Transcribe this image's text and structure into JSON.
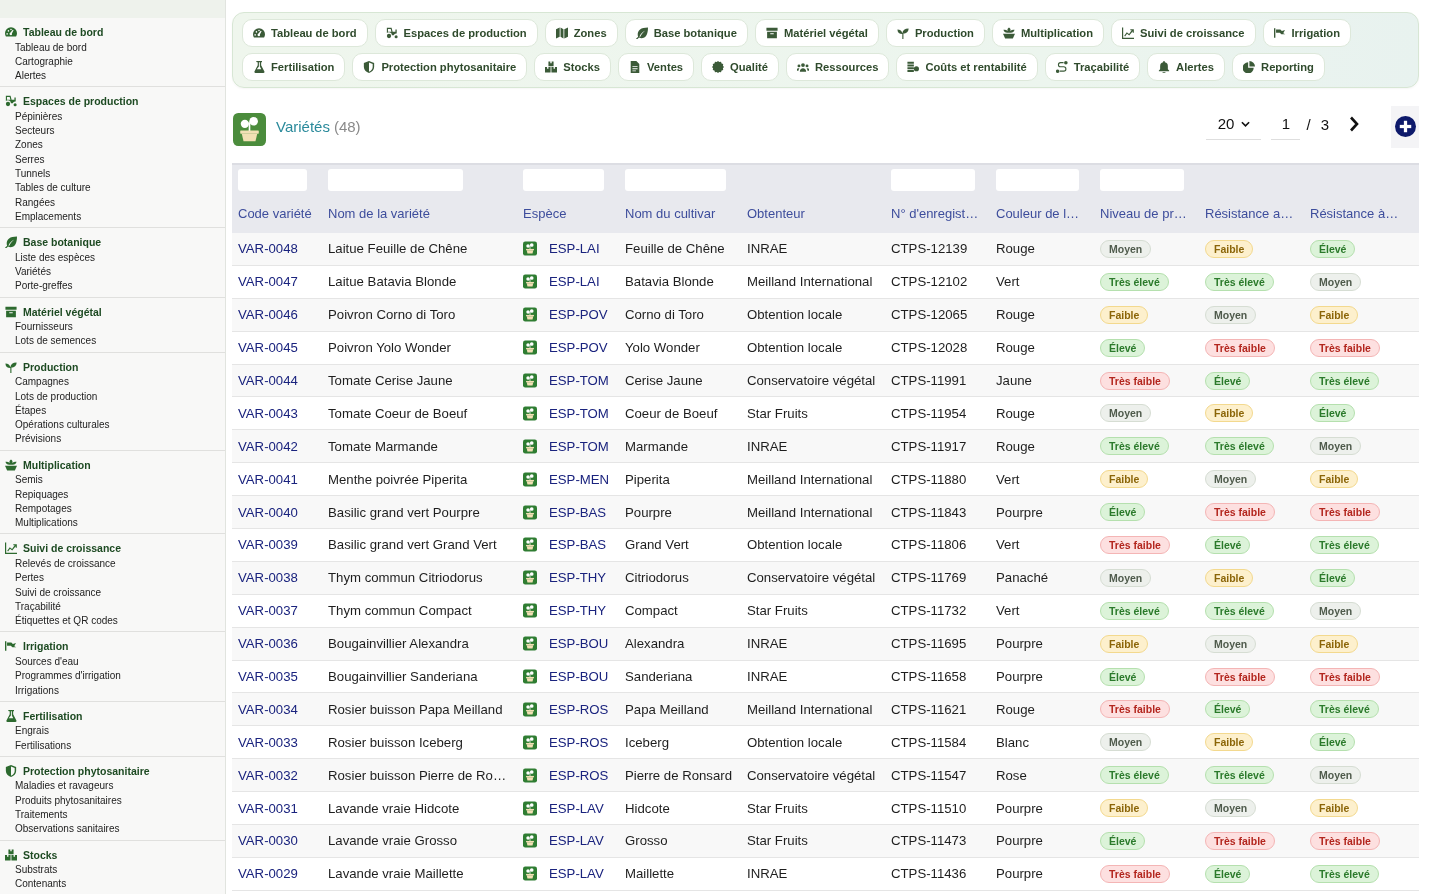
{
  "sidebar": {
    "groups": [
      {
        "title": "Tableau de bord",
        "items": [
          "Tableau de bord",
          "Cartographie",
          "Alertes"
        ]
      },
      {
        "title": "Espaces de production",
        "items": [
          "Pépinières",
          "Secteurs",
          "Zones",
          "Serres",
          "Tunnels",
          "Tables de culture",
          "Rangées",
          "Emplacements"
        ]
      },
      {
        "title": "Base botanique",
        "items": [
          "Liste des espèces",
          "Variétés",
          "Porte-greffes"
        ]
      },
      {
        "title": "Matériel végétal",
        "items": [
          "Fournisseurs",
          "Lots de semences"
        ]
      },
      {
        "title": "Production",
        "items": [
          "Campagnes",
          "Lots de production",
          "Étapes",
          "Opérations culturales",
          "Prévisions"
        ]
      },
      {
        "title": "Multiplication",
        "items": [
          "Semis",
          "Repiquages",
          "Rempotages",
          "Multiplications"
        ]
      },
      {
        "title": "Suivi de croissance",
        "items": [
          "Relevés de croissance",
          "Pertes",
          "Suivi de croissance",
          "Traçabilité",
          "Étiquettes et QR codes"
        ]
      },
      {
        "title": "Irrigation",
        "items": [
          "Sources d'eau",
          "Programmes d'irrigation",
          "Irrigations"
        ]
      },
      {
        "title": "Fertilisation",
        "items": [
          "Engrais",
          "Fertilisations"
        ]
      },
      {
        "title": "Protection phytosanitaire",
        "items": [
          "Maladies et ravageurs",
          "Produits phytosanitaires",
          "Traitements",
          "Observations sanitaires"
        ]
      },
      {
        "title": "Stocks",
        "items": [
          "Substrats",
          "Contenants"
        ]
      }
    ]
  },
  "nav": {
    "buttons": [
      "Tableau de bord",
      "Espaces de production",
      "Zones",
      "Base botanique",
      "Matériel végétal",
      "Production",
      "Multiplication",
      "Suivi de croissance",
      "Irrigation",
      "Fertilisation",
      "Protection phytosanitaire",
      "Stocks",
      "Ventes",
      "Qualité",
      "Ressources",
      "Coûts et rentabilité",
      "Traçabilité",
      "Alertes",
      "Reporting"
    ]
  },
  "page_header": {
    "title": "Variétés",
    "count": "(48)"
  },
  "pagination": {
    "page_size": "20",
    "page": "1",
    "separator": "/",
    "total_pages": "3"
  },
  "table": {
    "columns": [
      {
        "label": "Code variété",
        "kind": "link",
        "filterable": true
      },
      {
        "label": "Nom de la variété",
        "kind": "text",
        "filterable": true
      },
      {
        "label": "Espèce",
        "kind": "species",
        "filterable": true
      },
      {
        "label": "Nom du cultivar",
        "kind": "text",
        "filterable": true
      },
      {
        "label": "Obtenteur",
        "kind": "text",
        "filterable": false
      },
      {
        "label": "N° d'enregist…",
        "kind": "text",
        "filterable": true
      },
      {
        "label": "Couleur de l…",
        "kind": "text",
        "filterable": true
      },
      {
        "label": "Niveau de pr…",
        "kind": "badge",
        "filterable": true
      },
      {
        "label": "Résistance a…",
        "kind": "badge",
        "filterable": false
      },
      {
        "label": "Résistance à…",
        "kind": "badge",
        "filterable": false
      }
    ],
    "rows": [
      {
        "cells": [
          "VAR-0048",
          "Laitue Feuille de Chêne",
          "ESP-LAI",
          "Feuille de Chêne",
          "INRAE",
          "CTPS-12139",
          "Rouge",
          {
            "text": "Moyen",
            "kind": "neutral"
          },
          {
            "text": "Faible",
            "kind": "warning"
          },
          {
            "text": "Élevé",
            "kind": "success"
          }
        ]
      },
      {
        "cells": [
          "VAR-0047",
          "Laitue Batavia Blonde",
          "ESP-LAI",
          "Batavia Blonde",
          "Meilland International",
          "CTPS-12102",
          "Vert",
          {
            "text": "Très élevé",
            "kind": "success"
          },
          {
            "text": "Très élevé",
            "kind": "success"
          },
          {
            "text": "Moyen",
            "kind": "neutral"
          }
        ]
      },
      {
        "cells": [
          "VAR-0046",
          "Poivron Corno di Toro",
          "ESP-POV",
          "Corno di Toro",
          "Obtention locale",
          "CTPS-12065",
          "Rouge",
          {
            "text": "Faible",
            "kind": "warning"
          },
          {
            "text": "Moyen",
            "kind": "neutral"
          },
          {
            "text": "Faible",
            "kind": "warning"
          }
        ]
      },
      {
        "cells": [
          "VAR-0045",
          "Poivron Yolo Wonder",
          "ESP-POV",
          "Yolo Wonder",
          "Obtention locale",
          "CTPS-12028",
          "Rouge",
          {
            "text": "Élevé",
            "kind": "success"
          },
          {
            "text": "Très faible",
            "kind": "danger"
          },
          {
            "text": "Très faible",
            "kind": "danger"
          }
        ]
      },
      {
        "cells": [
          "VAR-0044",
          "Tomate Cerise Jaune",
          "ESP-TOM",
          "Cerise Jaune",
          "Conservatoire végétal",
          "CTPS-11991",
          "Jaune",
          {
            "text": "Très faible",
            "kind": "danger"
          },
          {
            "text": "Élevé",
            "kind": "success"
          },
          {
            "text": "Très élevé",
            "kind": "success"
          }
        ]
      },
      {
        "cells": [
          "VAR-0043",
          "Tomate Coeur de Boeuf",
          "ESP-TOM",
          "Coeur de Boeuf",
          "Star Fruits",
          "CTPS-11954",
          "Rouge",
          {
            "text": "Moyen",
            "kind": "neutral"
          },
          {
            "text": "Faible",
            "kind": "warning"
          },
          {
            "text": "Élevé",
            "kind": "success"
          }
        ]
      },
      {
        "cells": [
          "VAR-0042",
          "Tomate Marmande",
          "ESP-TOM",
          "Marmande",
          "INRAE",
          "CTPS-11917",
          "Rouge",
          {
            "text": "Très élevé",
            "kind": "success"
          },
          {
            "text": "Très élevé",
            "kind": "success"
          },
          {
            "text": "Moyen",
            "kind": "neutral"
          }
        ]
      },
      {
        "cells": [
          "VAR-0041",
          "Menthe poivrée Piperita",
          "ESP-MEN",
          "Piperita",
          "Meilland International",
          "CTPS-11880",
          "Vert",
          {
            "text": "Faible",
            "kind": "warning"
          },
          {
            "text": "Moyen",
            "kind": "neutral"
          },
          {
            "text": "Faible",
            "kind": "warning"
          }
        ]
      },
      {
        "cells": [
          "VAR-0040",
          "Basilic grand vert Pourpre",
          "ESP-BAS",
          "Pourpre",
          "Meilland International",
          "CTPS-11843",
          "Pourpre",
          {
            "text": "Élevé",
            "kind": "success"
          },
          {
            "text": "Très faible",
            "kind": "danger"
          },
          {
            "text": "Très faible",
            "kind": "danger"
          }
        ]
      },
      {
        "cells": [
          "VAR-0039",
          "Basilic grand vert Grand Vert",
          "ESP-BAS",
          "Grand Vert",
          "Obtention locale",
          "CTPS-11806",
          "Vert",
          {
            "text": "Très faible",
            "kind": "danger"
          },
          {
            "text": "Élevé",
            "kind": "success"
          },
          {
            "text": "Très élevé",
            "kind": "success"
          }
        ]
      },
      {
        "cells": [
          "VAR-0038",
          "Thym commun Citriodorus",
          "ESP-THY",
          "Citriodorus",
          "Conservatoire végétal",
          "CTPS-11769",
          "Panaché",
          {
            "text": "Moyen",
            "kind": "neutral"
          },
          {
            "text": "Faible",
            "kind": "warning"
          },
          {
            "text": "Élevé",
            "kind": "success"
          }
        ]
      },
      {
        "cells": [
          "VAR-0037",
          "Thym commun Compact",
          "ESP-THY",
          "Compact",
          "Star Fruits",
          "CTPS-11732",
          "Vert",
          {
            "text": "Très élevé",
            "kind": "success"
          },
          {
            "text": "Très élevé",
            "kind": "success"
          },
          {
            "text": "Moyen",
            "kind": "neutral"
          }
        ]
      },
      {
        "cells": [
          "VAR-0036",
          "Bougainvillier Alexandra",
          "ESP-BOU",
          "Alexandra",
          "INRAE",
          "CTPS-11695",
          "Pourpre",
          {
            "text": "Faible",
            "kind": "warning"
          },
          {
            "text": "Moyen",
            "kind": "neutral"
          },
          {
            "text": "Faible",
            "kind": "warning"
          }
        ]
      },
      {
        "cells": [
          "VAR-0035",
          "Bougainvillier Sanderiana",
          "ESP-BOU",
          "Sanderiana",
          "INRAE",
          "CTPS-11658",
          "Pourpre",
          {
            "text": "Élevé",
            "kind": "success"
          },
          {
            "text": "Très faible",
            "kind": "danger"
          },
          {
            "text": "Très faible",
            "kind": "danger"
          }
        ]
      },
      {
        "cells": [
          "VAR-0034",
          "Rosier buisson Papa Meilland",
          "ESP-ROS",
          "Papa Meilland",
          "Meilland International",
          "CTPS-11621",
          "Rouge",
          {
            "text": "Très faible",
            "kind": "danger"
          },
          {
            "text": "Élevé",
            "kind": "success"
          },
          {
            "text": "Très élevé",
            "kind": "success"
          }
        ]
      },
      {
        "cells": [
          "VAR-0033",
          "Rosier buisson Iceberg",
          "ESP-ROS",
          "Iceberg",
          "Obtention locale",
          "CTPS-11584",
          "Blanc",
          {
            "text": "Moyen",
            "kind": "neutral"
          },
          {
            "text": "Faible",
            "kind": "warning"
          },
          {
            "text": "Élevé",
            "kind": "success"
          }
        ]
      },
      {
        "cells": [
          "VAR-0032",
          "Rosier buisson Pierre de Ro…",
          "ESP-ROS",
          "Pierre de Ronsard",
          "Conservatoire végétal",
          "CTPS-11547",
          "Rose",
          {
            "text": "Très élevé",
            "kind": "success"
          },
          {
            "text": "Très élevé",
            "kind": "success"
          },
          {
            "text": "Moyen",
            "kind": "neutral"
          }
        ]
      },
      {
        "cells": [
          "VAR-0031",
          "Lavande vraie Hidcote",
          "ESP-LAV",
          "Hidcote",
          "Star Fruits",
          "CTPS-11510",
          "Pourpre",
          {
            "text": "Faible",
            "kind": "warning"
          },
          {
            "text": "Moyen",
            "kind": "neutral"
          },
          {
            "text": "Faible",
            "kind": "warning"
          }
        ]
      },
      {
        "cells": [
          "VAR-0030",
          "Lavande vraie Grosso",
          "ESP-LAV",
          "Grosso",
          "Star Fruits",
          "CTPS-11473",
          "Pourpre",
          {
            "text": "Élevé",
            "kind": "success"
          },
          {
            "text": "Très faible",
            "kind": "danger"
          },
          {
            "text": "Très faible",
            "kind": "danger"
          }
        ]
      },
      {
        "cells": [
          "VAR-0029",
          "Lavande vraie Maillette",
          "ESP-LAV",
          "Maillette",
          "INRAE",
          "CTPS-11436",
          "Pourpre",
          {
            "text": "Très faible",
            "kind": "danger"
          },
          {
            "text": "Élevé",
            "kind": "success"
          },
          {
            "text": "Très élevé",
            "kind": "success"
          }
        ]
      }
    ]
  }
}
